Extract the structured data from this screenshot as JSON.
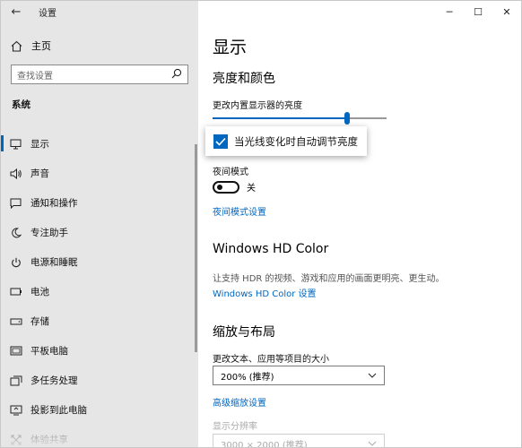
{
  "window": {
    "app_title": "设置",
    "controls": {
      "minimize": "─",
      "maximize": "☐",
      "close": "✕"
    }
  },
  "sidebar": {
    "home_label": "主页",
    "search_placeholder": "查找设置",
    "section_label": "系统",
    "items": [
      {
        "label": "显示",
        "icon": "monitor-icon",
        "active": true
      },
      {
        "label": "声音",
        "icon": "speaker-icon"
      },
      {
        "label": "通知和操作",
        "icon": "notification-icon"
      },
      {
        "label": "专注助手",
        "icon": "moon-icon"
      },
      {
        "label": "电源和睡眠",
        "icon": "power-icon"
      },
      {
        "label": "电池",
        "icon": "battery-icon"
      },
      {
        "label": "存储",
        "icon": "storage-icon"
      },
      {
        "label": "平板电脑",
        "icon": "tablet-icon"
      },
      {
        "label": "多任务处理",
        "icon": "multitask-icon"
      },
      {
        "label": "投影到此电脑",
        "icon": "project-icon"
      },
      {
        "label": "体验共享",
        "icon": "share-icon"
      }
    ]
  },
  "main": {
    "page_title": "显示",
    "brightness": {
      "heading": "亮度和颜色",
      "slider_label": "更改内置显示器的亮度",
      "slider_value": 0.78,
      "auto_checkbox_label": "当光线变化时自动调节亮度",
      "auto_checked": true,
      "night_mode_label": "夜间模式",
      "night_mode_state": "关",
      "night_mode_link": "夜间模式设置"
    },
    "hdr": {
      "heading": "Windows HD Color",
      "description": "让支持 HDR 的视频、游戏和应用的画面更明亮、更生动。",
      "link": "Windows HD Color 设置"
    },
    "scale": {
      "heading": "缩放与布局",
      "scale_label": "更改文本、应用等项目的大小",
      "scale_value": "200% (推荐)",
      "advanced_link": "高级缩放设置",
      "resolution_label": "显示分辨率",
      "resolution_value": "3000 × 2000 (推荐)"
    }
  },
  "colors": {
    "accent": "#0067c0",
    "sidebar_bg": "#e6e6e6"
  }
}
